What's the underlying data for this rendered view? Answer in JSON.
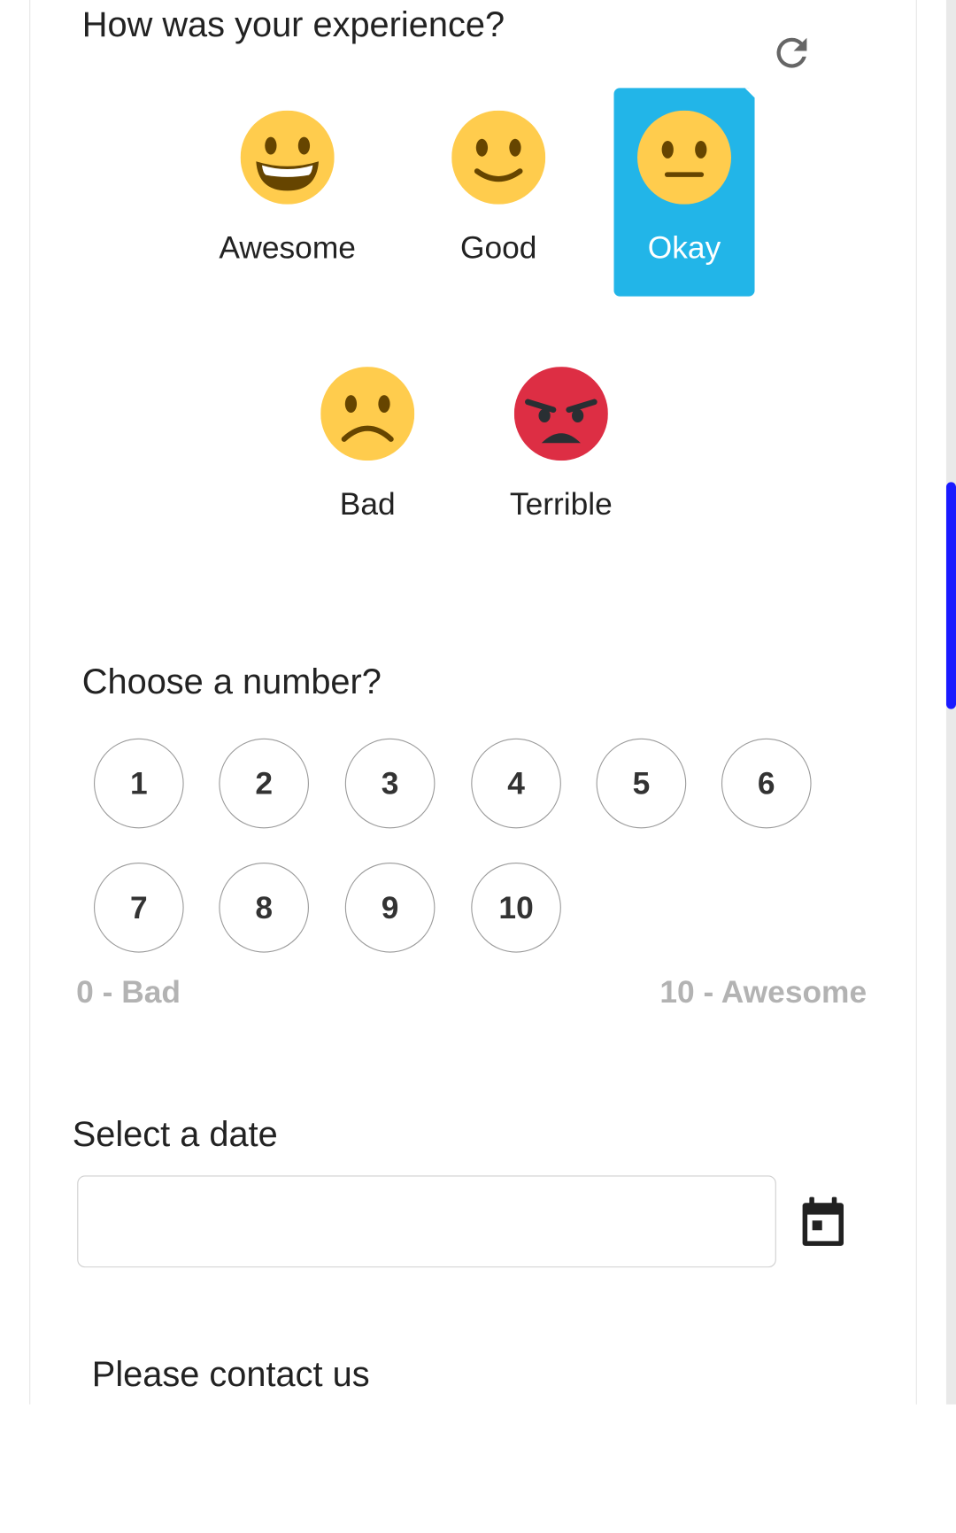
{
  "experience": {
    "question": "How was your experience?",
    "options": [
      {
        "label": "Awesome",
        "icon": "grinning-face-icon"
      },
      {
        "label": "Good",
        "icon": "slightly-smiling-face-icon"
      },
      {
        "label": "Okay",
        "icon": "neutral-face-icon",
        "selected": true
      },
      {
        "label": "Bad",
        "icon": "frowning-face-icon"
      },
      {
        "label": "Terrible",
        "icon": "angry-face-icon"
      }
    ],
    "refresh_icon": "refresh-icon"
  },
  "number": {
    "question": "Choose a number?",
    "values": [
      "1",
      "2",
      "3",
      "4",
      "5",
      "6",
      "7",
      "8",
      "9",
      "10"
    ],
    "min_label": "0 - Bad",
    "max_label": "10 - Awesome"
  },
  "date": {
    "label": "Select a date",
    "value": "",
    "calendar_icon": "calendar-icon"
  },
  "contact": {
    "label": "Please contact us"
  },
  "colors": {
    "selected_bg": "#22b5e8",
    "emoji_yellow": "#ffcc4d",
    "angry_red": "#dd2e44",
    "scroll_thumb": "#1a1aff",
    "hint_gray": "#b3b3b3"
  }
}
